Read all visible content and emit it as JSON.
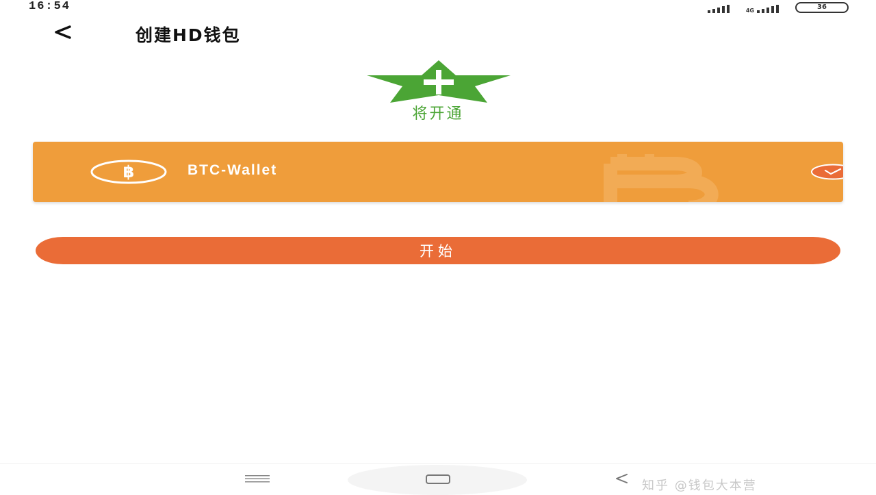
{
  "status_bar": {
    "time": "16:54",
    "network_label": "4G",
    "battery": "36"
  },
  "header": {
    "title": "创建HD钱包"
  },
  "hero": {
    "label": "将开通"
  },
  "wallet": {
    "name": "BTC-Wallet",
    "selected": true
  },
  "start_button": {
    "label": "开始"
  },
  "watermark": {
    "text": "知乎 @钱包大本营"
  },
  "colors": {
    "wallet_card": "#ef9d3b",
    "start_button": "#ea6c37",
    "hero_green": "#4ba535"
  }
}
